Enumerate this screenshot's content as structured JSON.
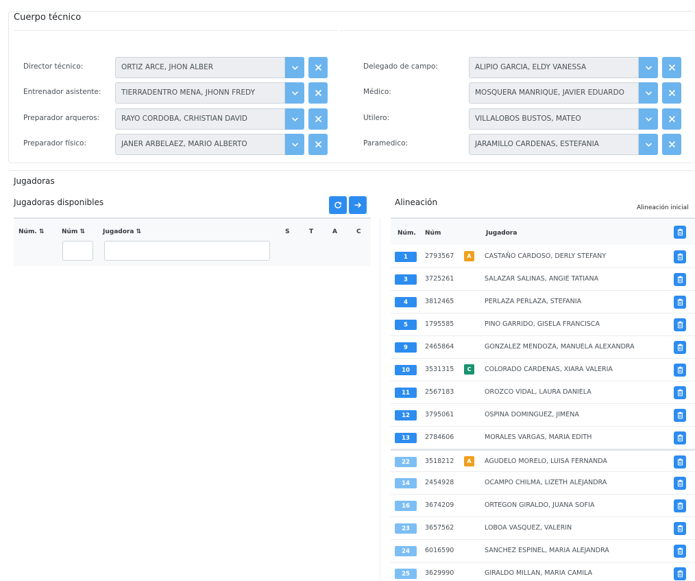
{
  "staff": {
    "title": "Cuerpo técnico",
    "left": [
      {
        "label": "Director técnico:",
        "value": "ORTIZ ARCE, JHON ALBER"
      },
      {
        "label": "Entrenador asistente:",
        "value": "TIERRADENTRO MENA, JHONN FREDY"
      },
      {
        "label": "Preparador arqueros:",
        "value": "RAYO CORDOBA, CRHISTIAN DAVID"
      },
      {
        "label": "Preparador físico:",
        "value": "JANER ARBELAEZ, MARIO ALBERTO"
      }
    ],
    "right": [
      {
        "label": "Delegado de campo:",
        "value": "ALIPIO GARCIA, ELDY VANESSA"
      },
      {
        "label": "Médico:",
        "value": "MOSQUERA MANRIQUE, JAVIER EDUARDO"
      },
      {
        "label": "Utilero:",
        "value": "VILLALOBOS BUSTOS, MATEO"
      },
      {
        "label": "Paramedico:",
        "value": "JARAMILLO CARDENAS, ESTEFANIA"
      }
    ]
  },
  "players": {
    "title": "Jugadoras",
    "available": {
      "title": "Jugadoras disponibles",
      "headers": {
        "num_sort": "Núm. ⇅",
        "num2_sort": "Núm ⇅",
        "player_sort": "Jugadora ⇅",
        "s": "S",
        "t": "T",
        "a": "A",
        "c": "C"
      },
      "filter_num_placeholder": "",
      "filter_name_placeholder": ""
    },
    "lineup": {
      "title": "Alineación",
      "initial_label": "Alineación inicial",
      "headers": {
        "num": "Núm.",
        "doc": "Núm",
        "player": "Jugadora"
      },
      "rows": [
        {
          "num": "1",
          "doc": "2793567",
          "role": "A",
          "name": "CASTAÑO CARDOSO, DERLY STEFANY",
          "starter": true
        },
        {
          "num": "3",
          "doc": "3725261",
          "role": "",
          "name": "SALAZAR SALINAS, ANGIE TATIANA",
          "starter": true
        },
        {
          "num": "4",
          "doc": "3812465",
          "role": "",
          "name": "PERLAZA PERLAZA, STEFANIA",
          "starter": true
        },
        {
          "num": "5",
          "doc": "1795585",
          "role": "",
          "name": "PINO GARRIDO, GISELA FRANCISCA",
          "starter": true
        },
        {
          "num": "9",
          "doc": "2465864",
          "role": "",
          "name": "GONZALEZ MENDOZA, MANUELA ALEXANDRA",
          "starter": true
        },
        {
          "num": "10",
          "doc": "3531315",
          "role": "C",
          "name": "COLORADO CARDENAS, XIARA VALERIA",
          "starter": true
        },
        {
          "num": "11",
          "doc": "2567183",
          "role": "",
          "name": "OROZCO VIDAL, LAURA DANIELA",
          "starter": true
        },
        {
          "num": "12",
          "doc": "3795061",
          "role": "",
          "name": "OSPINA DOMINGUEZ, JIMENA",
          "starter": true
        },
        {
          "num": "13",
          "doc": "2784606",
          "role": "",
          "name": "MORALES VARGAS, MARIA EDITH",
          "starter": true
        },
        {
          "num": "22",
          "doc": "3518212",
          "role": "A",
          "name": "AGUDELO MORELO, LUISA FERNANDA",
          "starter": false
        },
        {
          "num": "14",
          "doc": "2454928",
          "role": "",
          "name": "OCAMPO CHILMA, LIZETH ALEJANDRA",
          "starter": false
        },
        {
          "num": "16",
          "doc": "3674209",
          "role": "",
          "name": "ORTEGON GIRALDO, JUANA SOFIA",
          "starter": false
        },
        {
          "num": "23",
          "doc": "3657562",
          "role": "",
          "name": "LOBOA VASQUEZ, VALERIN",
          "starter": false
        },
        {
          "num": "24",
          "doc": "6016590",
          "role": "",
          "name": "SANCHEZ ESPINEL, MARIA ALEJANDRA",
          "starter": false
        },
        {
          "num": "25",
          "doc": "3629990",
          "role": "",
          "name": "GIRALDO MILLAN, MARIA CAMILA",
          "starter": false
        }
      ]
    }
  },
  "icons": {
    "dropdown": "chevron-down-icon",
    "clear": "close-icon",
    "refresh": "refresh-icon",
    "move": "arrow-right-icon",
    "delete": "trash-icon"
  },
  "colors": {
    "primary": "#2d8cf0",
    "primary_light": "#7dbef4",
    "control_button": "#6cb4ee",
    "badge_A": "#f0a01e",
    "badge_C": "#1a9370"
  }
}
